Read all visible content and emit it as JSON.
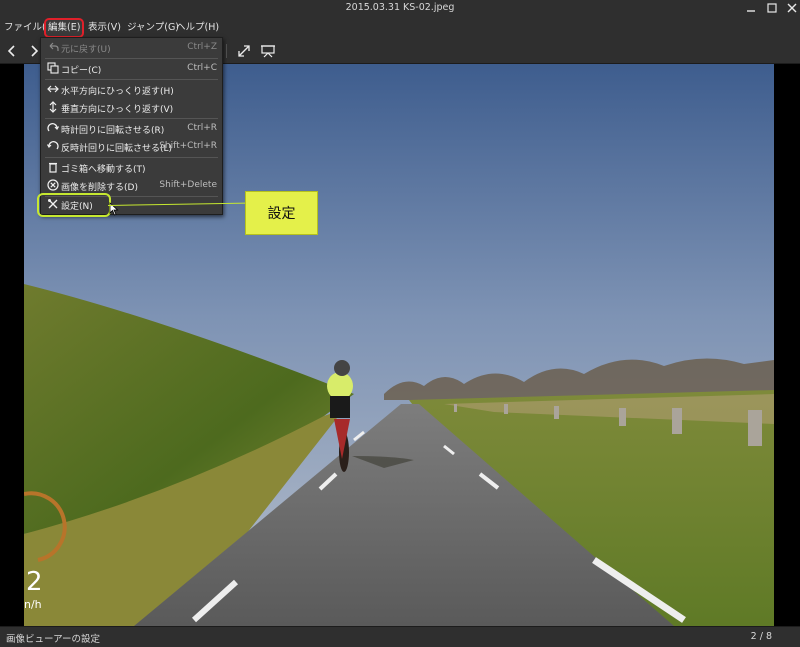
{
  "window": {
    "title": "2015.03.31 KS-02.jpeg",
    "minimize_icon": "minimize-icon",
    "maximize_icon": "maximize-icon",
    "close_icon": "close-icon"
  },
  "menubar": {
    "items": [
      {
        "label": "ファイル(F)"
      },
      {
        "label": "編集(E)",
        "active": true
      },
      {
        "label": "表示(V)"
      },
      {
        "label": "ジャンプ(G)"
      },
      {
        "label": "ヘルプ(H)"
      }
    ]
  },
  "toolbar": {
    "icons": [
      "back-icon",
      "forward-icon",
      "fullscreen-icon",
      "slideshow-icon"
    ]
  },
  "edit_menu": {
    "items": [
      {
        "label": "元に戻す(U)",
        "shortcut": "Ctrl+Z",
        "icon": "undo-icon",
        "disabled": true
      },
      {
        "label": "コピー(C)",
        "shortcut": "Ctrl+C",
        "icon": "copy-icon"
      },
      {
        "label": "水平方向にひっくり返す(H)",
        "shortcut": "",
        "icon": "flip-horizontal-icon"
      },
      {
        "label": "垂直方向にひっくり返す(V)",
        "shortcut": "",
        "icon": "flip-vertical-icon"
      },
      {
        "label": "時計回りに回転させる(R)",
        "shortcut": "Ctrl+R",
        "icon": "rotate-clockwise-icon"
      },
      {
        "label": "反時計回りに回転させる(L)",
        "shortcut": "Shift+Ctrl+R",
        "icon": "rotate-counterclockwise-icon"
      },
      {
        "label": "ゴミ箱へ移動する(T)",
        "shortcut": "",
        "icon": "trash-icon"
      },
      {
        "label": "画像を削除する(D)",
        "shortcut": "Shift+Delete",
        "icon": "delete-icon"
      },
      {
        "label": "設定(N)",
        "shortcut": "",
        "icon": "settings-icon",
        "highlighted": true
      }
    ]
  },
  "callout": {
    "label": "設定"
  },
  "photo": {
    "speed_value": "2",
    "speed_unit": "n/h"
  },
  "statusbar": {
    "left": "画像ビューアーの設定",
    "right": "2 / 8"
  },
  "colors": {
    "highlight_red": "#e0202a",
    "highlight_lime": "#c6e830",
    "callout_fill": "#e4f04a"
  }
}
